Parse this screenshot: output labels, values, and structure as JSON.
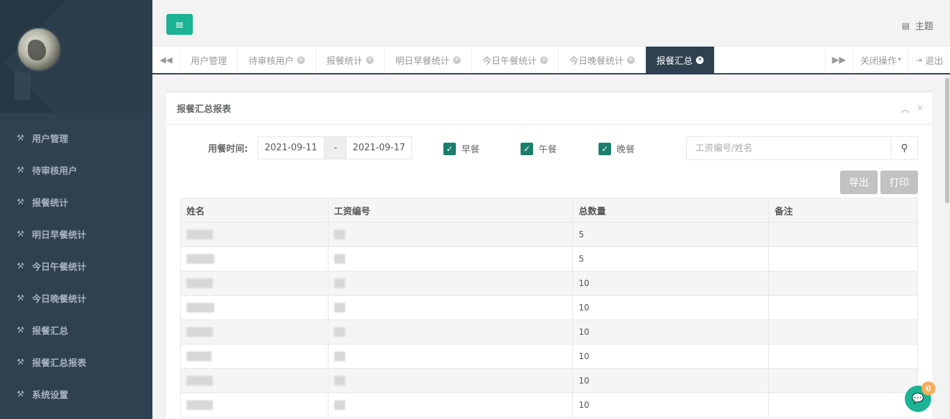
{
  "sidebar": {
    "items": [
      {
        "label": "用户管理"
      },
      {
        "label": "待审核用户"
      },
      {
        "label": "报餐统计"
      },
      {
        "label": "明日早餐统计"
      },
      {
        "label": "今日午餐统计"
      },
      {
        "label": "今日晚餐统计"
      },
      {
        "label": "报餐汇总"
      },
      {
        "label": "报餐汇总报表"
      },
      {
        "label": "系统设置"
      }
    ]
  },
  "topbar": {
    "menu_icon": "≡",
    "theme_label": "主题"
  },
  "tabs": {
    "items": [
      {
        "label": "用户管理",
        "closable": false
      },
      {
        "label": "待审核用户",
        "closable": true
      },
      {
        "label": "报餐统计",
        "closable": true
      },
      {
        "label": "明日早餐统计",
        "closable": true
      },
      {
        "label": "今日午餐统计",
        "closable": true
      },
      {
        "label": "今日晚餐统计",
        "closable": true
      },
      {
        "label": "报餐汇总",
        "closable": true,
        "active": true
      }
    ],
    "close_ops": "关闭操作",
    "logout": "退出"
  },
  "panel": {
    "title": "报餐汇总报表"
  },
  "filter": {
    "label": "用餐时间:",
    "date_start": "2021-09-11",
    "date_sep": "-",
    "date_end": "2021-09-17",
    "breakfast": "早餐",
    "lunch": "午餐",
    "dinner": "晚餐",
    "search_placeholder": "工资编号/姓名"
  },
  "actions": {
    "export": "导出",
    "print": "打印"
  },
  "table": {
    "headers": [
      "姓名",
      "工资编号",
      "总数量",
      "备注"
    ],
    "rows": [
      {
        "total": "5"
      },
      {
        "total": "5"
      },
      {
        "total": "10"
      },
      {
        "total": "10"
      },
      {
        "total": "10"
      },
      {
        "total": "10"
      },
      {
        "total": "10"
      },
      {
        "total": "10"
      }
    ]
  },
  "chat": {
    "badge": "0"
  },
  "colors": {
    "sidebar_bg": "#2f4050",
    "accent": "#1ab394",
    "active_tab": "#2f4050",
    "checkbox": "#1a7f6c"
  }
}
